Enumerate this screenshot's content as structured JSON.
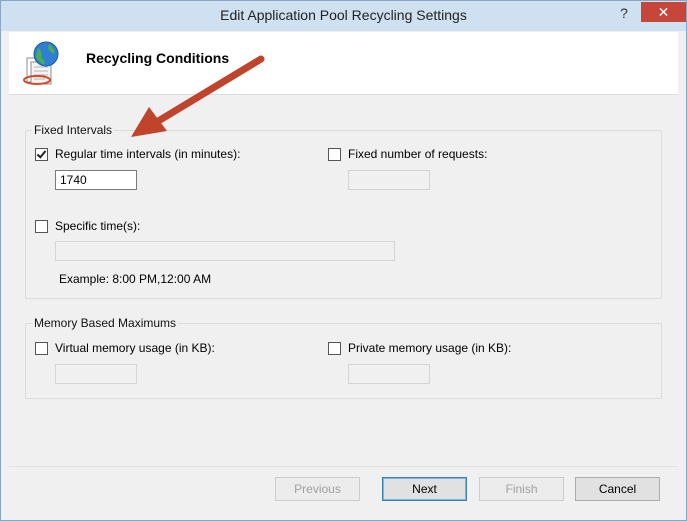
{
  "window": {
    "title": "Edit Application Pool Recycling Settings",
    "help_glyph": "?",
    "close_glyph": "✕"
  },
  "header": {
    "heading": "Recycling Conditions"
  },
  "fixed_intervals": {
    "legend": "Fixed Intervals",
    "regular_time": {
      "label": "Regular time intervals (in minutes):",
      "checked": true,
      "value": "1740"
    },
    "fixed_requests": {
      "label": "Fixed number of requests:",
      "checked": false,
      "value": ""
    },
    "specific_times": {
      "label": "Specific time(s):",
      "checked": false,
      "value": ""
    },
    "example": "Example: 8:00 PM,12:00 AM"
  },
  "memory": {
    "legend": "Memory Based Maximums",
    "virtual": {
      "label": "Virtual memory usage (in KB):",
      "checked": false,
      "value": ""
    },
    "private": {
      "label": "Private memory usage (in KB):",
      "checked": false,
      "value": ""
    }
  },
  "buttons": {
    "previous": "Previous",
    "next": "Next",
    "finish": "Finish",
    "cancel": "Cancel"
  },
  "colors": {
    "arrow": "#c0432b",
    "close_button": "#c7463a",
    "titlebar": "#cfe0f1"
  }
}
